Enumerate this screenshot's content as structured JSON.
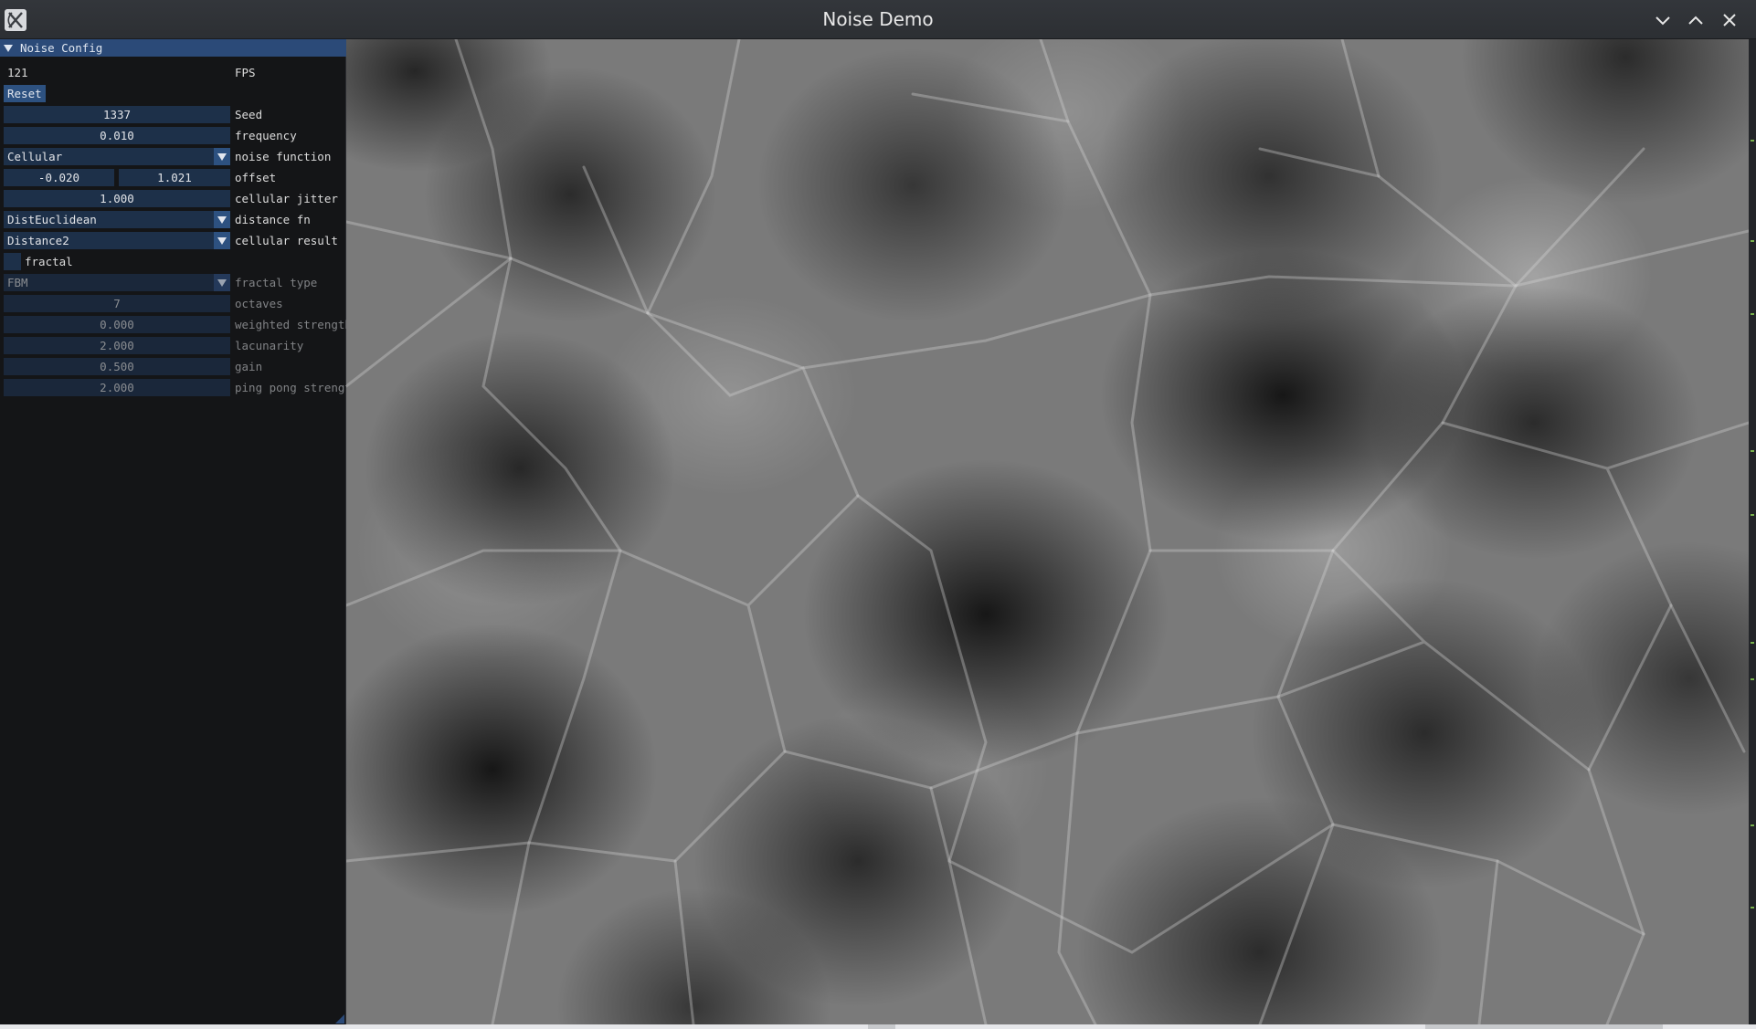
{
  "window": {
    "title": "Noise Demo",
    "icons": {
      "app": "app-logo-icon",
      "minimize": "chevron-down-icon",
      "maximize": "chevron-up-icon",
      "close": "close-icon"
    }
  },
  "panel": {
    "title": "Noise Config",
    "fps": {
      "value": "121",
      "label": "FPS"
    },
    "reset_label": "Reset",
    "seed": {
      "value": "1337",
      "label": "Seed"
    },
    "frequency": {
      "value": "0.010",
      "label": "frequency"
    },
    "noise_function": {
      "value": "Cellular",
      "label": "noise function"
    },
    "offset": {
      "x": "-0.020",
      "y": "1.021",
      "label": "offset"
    },
    "cellular_jitter": {
      "value": "1.000",
      "label": "cellular jitter"
    },
    "distance_fn": {
      "value": "DistEuclidean",
      "label": "distance fn"
    },
    "cellular_result": {
      "value": "Distance2",
      "label": "cellular result"
    },
    "fractal": {
      "checked": false,
      "label": "fractal"
    },
    "fractal_type": {
      "value": "FBM",
      "label": "fractal type"
    },
    "octaves": {
      "value": "7",
      "label": "octaves"
    },
    "weighted_strength": {
      "value": "0.000",
      "label": "weighted strength"
    },
    "lacunarity": {
      "value": "2.000",
      "label": "lacunarity"
    },
    "gain": {
      "value": "0.500",
      "label": "gain"
    },
    "ping_pong_strength": {
      "value": "2.000",
      "label": "ping pong strength"
    }
  },
  "colors": {
    "header_bg": "#2b4a78",
    "frame_bg": "#1d3049",
    "button_bg": "#2d5180",
    "panel_bg": "#141517",
    "titlebar_bg": "#2f3236"
  }
}
